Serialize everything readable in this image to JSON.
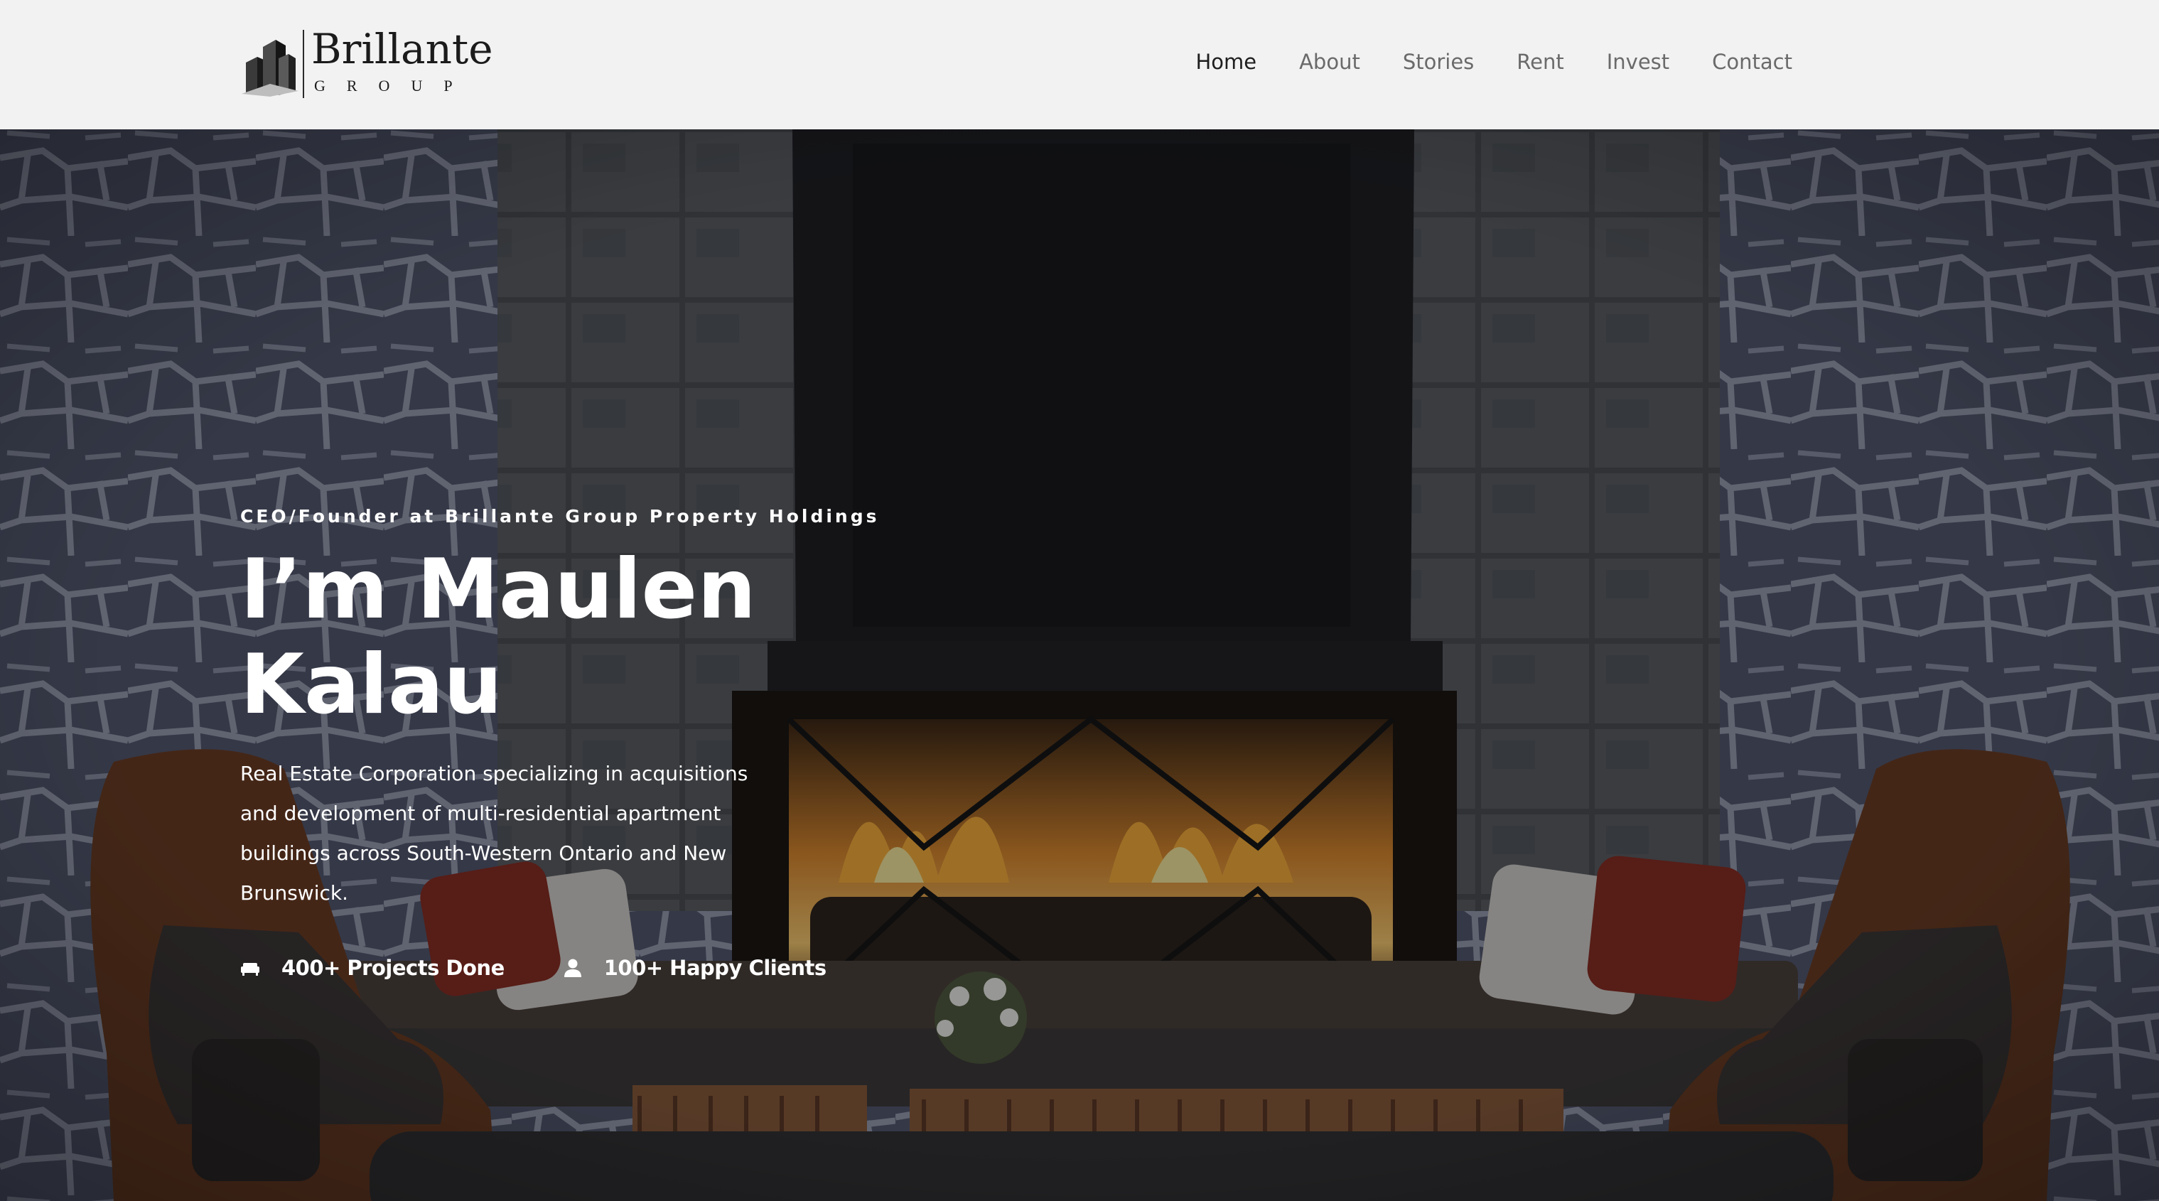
{
  "header": {
    "logo": {
      "name": "Brillante",
      "sub": "GROUP"
    },
    "nav": [
      {
        "label": "Home",
        "active": true
      },
      {
        "label": "About",
        "active": false
      },
      {
        "label": "Stories",
        "active": false
      },
      {
        "label": "Rent",
        "active": false
      },
      {
        "label": "Invest",
        "active": false
      },
      {
        "label": "Contact",
        "active": false
      }
    ]
  },
  "hero": {
    "eyebrow": "CEO/Founder at Brillante Group Property Holdings",
    "headline": "I’m Maulen Kalau",
    "description": "Real Estate Corporation specializing in acquisitions and development of multi-residential apartment buildings across South-Western Ontario and New Brunswick.",
    "stats": [
      {
        "icon": "sofa-icon",
        "label": "400+ Projects Done"
      },
      {
        "icon": "user-icon",
        "label": "100+ Happy Clients"
      }
    ]
  },
  "colors": {
    "header_bg": "#f2f2f2",
    "nav_active": "#1e1e1e",
    "nav_inactive": "#6a6a6a",
    "hero_text": "#ffffff"
  }
}
